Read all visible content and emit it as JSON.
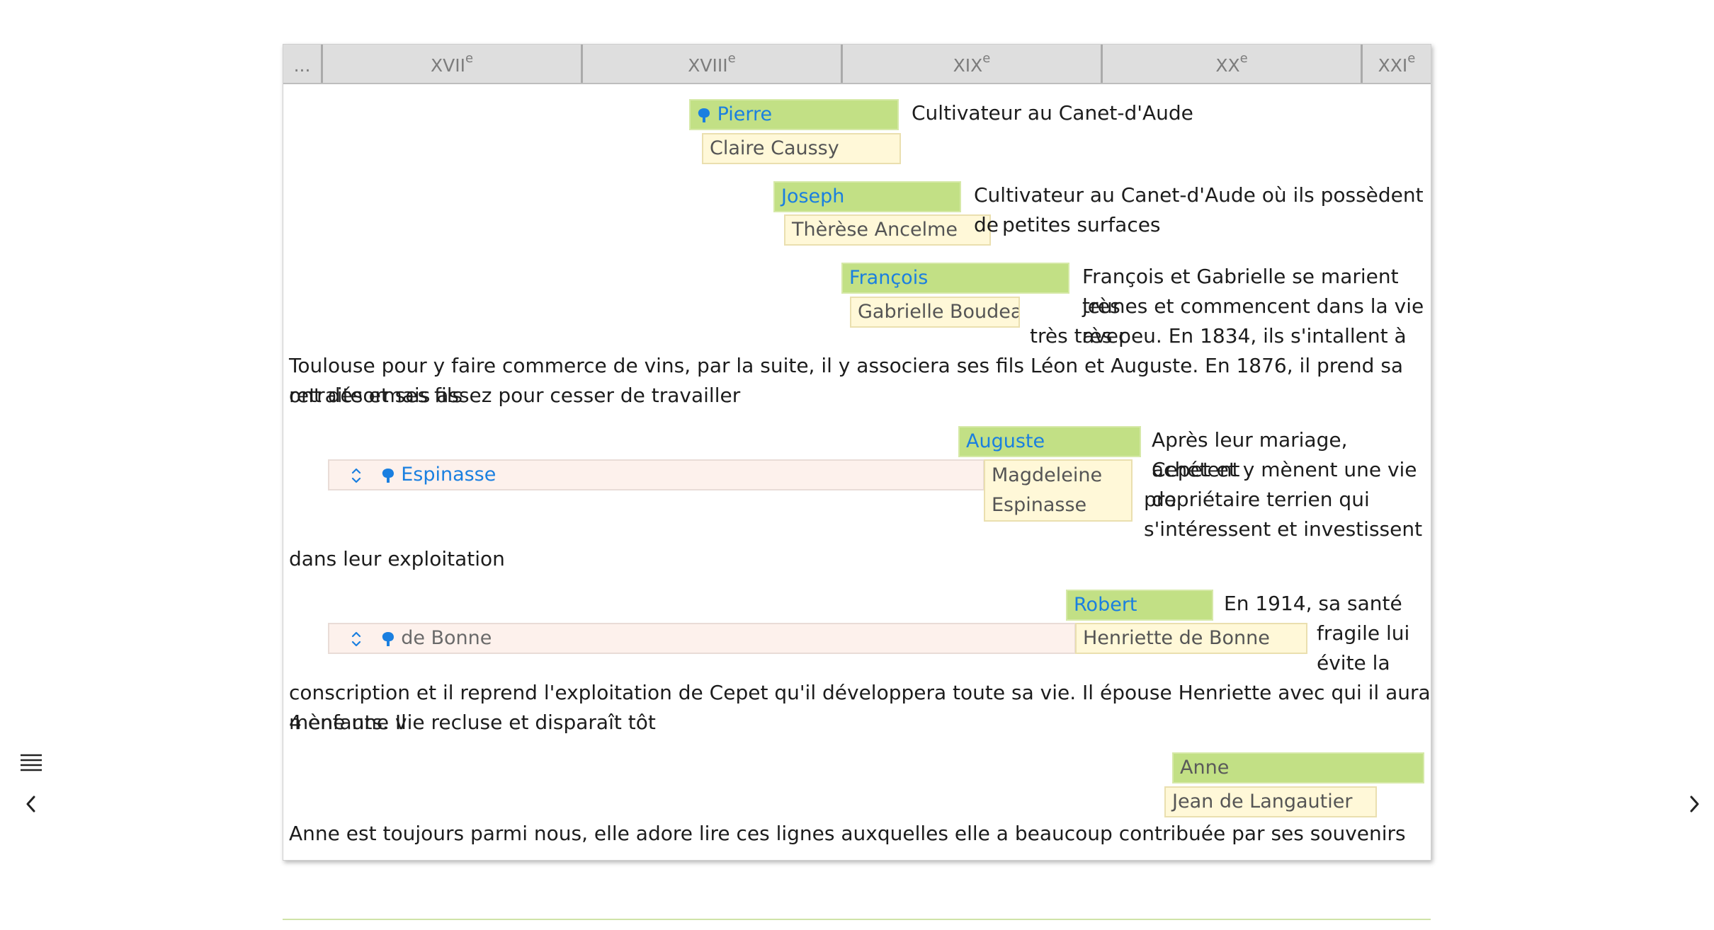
{
  "timeline": {
    "ellipsis": "...",
    "centuries": [
      {
        "roman": "XVII",
        "sup": "e"
      },
      {
        "roman": "XVIII",
        "sup": "e"
      },
      {
        "roman": "XIX",
        "sup": "e"
      },
      {
        "roman": "XX",
        "sup": "e"
      },
      {
        "roman": "XXI",
        "sup": "e"
      }
    ]
  },
  "generations": {
    "pierre": {
      "name": "Pierre",
      "spouse": "Claire Caussy",
      "desc": "Cultivateur au Canet-d'Aude"
    },
    "joseph": {
      "name": "Joseph",
      "spouse": "Thèrèse Ancelme",
      "desc_l1": "Cultivateur au Canet-d'Aude où ils possèdent de",
      "desc_l2": "petites surfaces"
    },
    "francois": {
      "name": "François",
      "spouse": "Gabrielle Boudeau",
      "desc_l1": "François et Gabrielle se marient très",
      "desc_l2": "jeunes et commencent dans la vie avec",
      "desc_l3": "très très peu. En 1834, ils s'intallent à",
      "desc_l4": "Toulouse pour y faire commerce de vins, par la suite, il y associera ses fils Léon et Auguste. En 1876, il prend sa retraite et ses fils",
      "desc_l5": "ont désormais assez pour cesser de travailler"
    },
    "auguste": {
      "name": "Auguste",
      "spouse": "Magdeleine Espinasse",
      "family": "Espinasse",
      "desc_l1": "Après leur mariage, achétent",
      "desc_l2": "Cepet et y mènent une vie de",
      "desc_l3": "propriétaire terrien qui",
      "desc_l4": "s'intéressent et investissent",
      "desc_l5": "dans leur exploitation"
    },
    "robert": {
      "name": "Robert",
      "spouse": "Henriette de Bonne",
      "family": "de Bonne",
      "desc_l1": "En 1914, sa santé",
      "desc_l2": "fragile lui",
      "desc_l3": "évite la",
      "desc_l4": "conscription et il reprend l'exploitation de Cepet qu'il développera toute sa vie. Il épouse Henriette avec qui il aura 4 enfants. Il",
      "desc_l5": "mène une vie recluse et disparaît tôt"
    },
    "anne": {
      "name": "Anne",
      "spouse": "Jean de Langautier",
      "desc": "Anne est toujours parmi nous, elle adore lire ces lignes auxquelles elle a beaucoup contribuée par ses souvenirs"
    }
  },
  "colors": {
    "person_bg": "#c2e085",
    "spouse_bg": "#fff8d8",
    "family_bg": "#fdf1ec",
    "link": "#1a7fe0"
  }
}
